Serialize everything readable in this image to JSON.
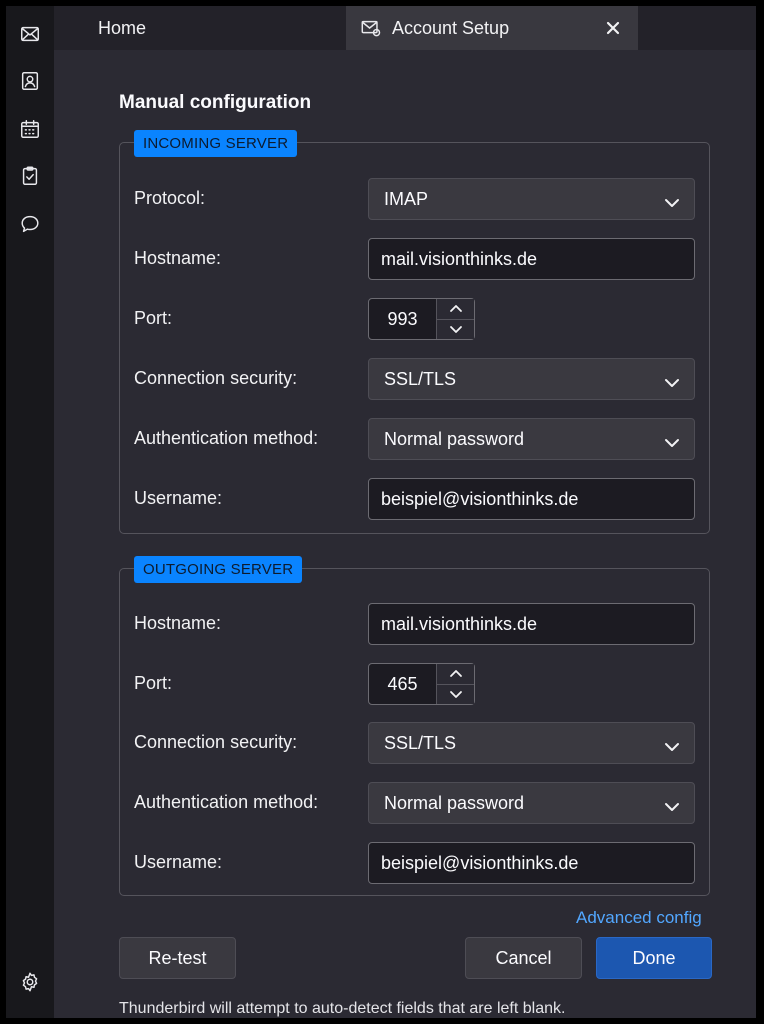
{
  "tabs": {
    "home_label": "Home",
    "account_setup_label": "Account Setup"
  },
  "page_title": "Manual configuration",
  "incoming": {
    "legend": "INCOMING SERVER",
    "protocol_label": "Protocol:",
    "protocol_value": "IMAP",
    "hostname_label": "Hostname:",
    "hostname_value": "mail.visionthinks.de",
    "port_label": "Port:",
    "port_value": "993",
    "security_label": "Connection security:",
    "security_value": "SSL/TLS",
    "auth_label": "Authentication method:",
    "auth_value": "Normal password",
    "username_label": "Username:",
    "username_value": "beispiel@visionthinks.de"
  },
  "outgoing": {
    "legend": "OUTGOING SERVER",
    "hostname_label": "Hostname:",
    "hostname_value": "mail.visionthinks.de",
    "port_label": "Port:",
    "port_value": "465",
    "security_label": "Connection security:",
    "security_value": "SSL/TLS",
    "auth_label": "Authentication method:",
    "auth_value": "Normal password",
    "username_label": "Username:",
    "username_value": "beispiel@visionthinks.de"
  },
  "advanced_link": "Advanced config",
  "buttons": {
    "retest": "Re-test",
    "cancel": "Cancel",
    "done": "Done"
  },
  "footnote": "Thunderbird will attempt to auto-detect fields that are left blank.",
  "spaces_icons": [
    "mail-icon",
    "address-book-icon",
    "calendar-icon",
    "tasks-icon",
    "chat-icon",
    "settings-icon"
  ],
  "colors": {
    "accent": "#0a84ff",
    "primary_button": "#1c57b0",
    "link": "#52a7ff",
    "background": "#2b2a33"
  }
}
